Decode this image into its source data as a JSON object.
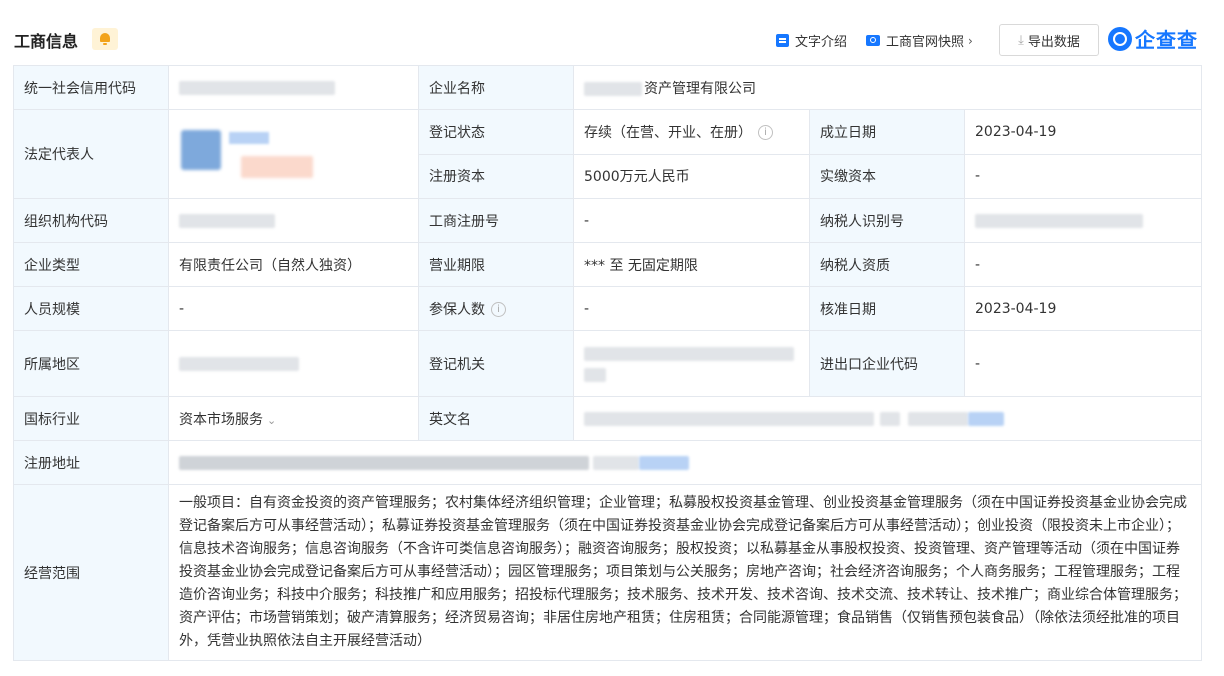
{
  "header": {
    "title": "工商信息",
    "icon": "bell-icon",
    "intro_link": "文字介绍",
    "snapshot_link": "工商官网快照",
    "export_label": "导出数据",
    "brand": "企查查"
  },
  "fields": {
    "credit_code_label": "统一社会信用代码",
    "company_name_label": "企业名称",
    "company_name_suffix": "资产管理有限公司",
    "legal_rep_label": "法定代表人",
    "reg_status_label": "登记状态",
    "reg_status_value": "存续（在营、开业、在册）",
    "found_date_label": "成立日期",
    "found_date_value": "2023-04-19",
    "reg_capital_label": "注册资本",
    "reg_capital_value": "5000万元人民币",
    "paid_capital_label": "实缴资本",
    "paid_capital_value": "-",
    "org_code_label": "组织机构代码",
    "biz_reg_no_label": "工商注册号",
    "biz_reg_no_value": "-",
    "tax_id_label": "纳税人识别号",
    "company_type_label": "企业类型",
    "company_type_value": "有限责任公司（自然人独资）",
    "biz_term_label": "营业期限",
    "biz_term_value": "*** 至 无固定期限",
    "taxpayer_qual_label": "纳税人资质",
    "taxpayer_qual_value": "-",
    "staff_size_label": "人员规模",
    "staff_size_value": "-",
    "insured_label": "参保人数",
    "insured_value": "-",
    "approve_date_label": "核准日期",
    "approve_date_value": "2023-04-19",
    "region_label": "所属地区",
    "reg_authority_label": "登记机关",
    "ie_code_label": "进出口企业代码",
    "ie_code_value": "-",
    "industry_label": "国标行业",
    "industry_value": "资本市场服务",
    "english_name_label": "英文名",
    "reg_address_label": "注册地址",
    "scope_label": "经营范围",
    "scope_value": "一般项目：自有资金投资的资产管理服务；农村集体经济组织管理；企业管理；私募股权投资基金管理、创业投资基金管理服务（须在中国证券投资基金业协会完成登记备案后方可从事经营活动）；私募证券投资基金管理服务（须在中国证券投资基金业协会完成登记备案后方可从事经营活动）；创业投资（限投资未上市企业）；信息技术咨询服务；信息咨询服务（不含许可类信息咨询服务）；融资咨询服务；股权投资；以私募基金从事股权投资、投资管理、资产管理等活动（须在中国证券投资基金业协会完成登记备案后方可从事经营活动）；园区管理服务；项目策划与公关服务；房地产咨询；社会经济咨询服务；个人商务服务；工程管理服务；工程造价咨询业务；科技中介服务；科技推广和应用服务；招投标代理服务；技术服务、技术开发、技术咨询、技术交流、技术转让、技术推广；商业综合体管理服务；资产评估；市场营销策划；破产清算服务；经济贸易咨询；非居住房地产租赁；住房租赁；合同能源管理；食品销售（仅销售预包装食品）（除依法须经批准的项目外，凭营业执照依法自主开展经营活动）"
  }
}
